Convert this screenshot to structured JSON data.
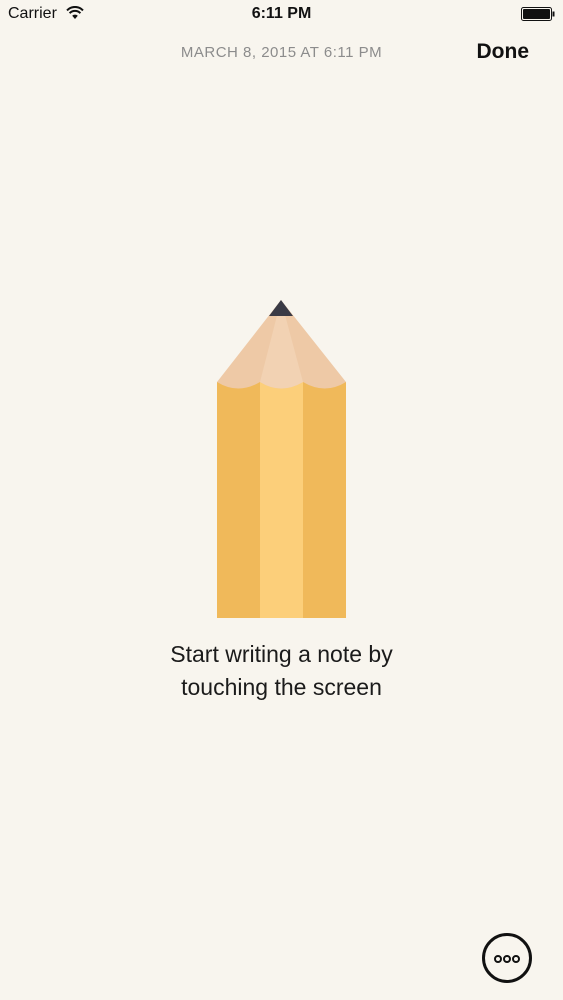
{
  "status_bar": {
    "carrier": "Carrier",
    "time": "6:11 PM",
    "wifi_icon": "wifi-icon",
    "battery_icon": "battery-icon"
  },
  "nav": {
    "date": "MARCH 8, 2015 AT 6:11 PM",
    "done_label": "Done"
  },
  "empty_state": {
    "illustration": "pencil-icon",
    "line1": "Start writing a note by",
    "line2": "touching the screen"
  },
  "more_button": {
    "icon": "more-dots-icon"
  },
  "colors": {
    "background": "#f8f5ee",
    "pencil_body": "#f0b95a",
    "pencil_body_highlight": "#fccf7a",
    "pencil_wood": "#eec9a6",
    "pencil_lead": "#3a3a45"
  }
}
